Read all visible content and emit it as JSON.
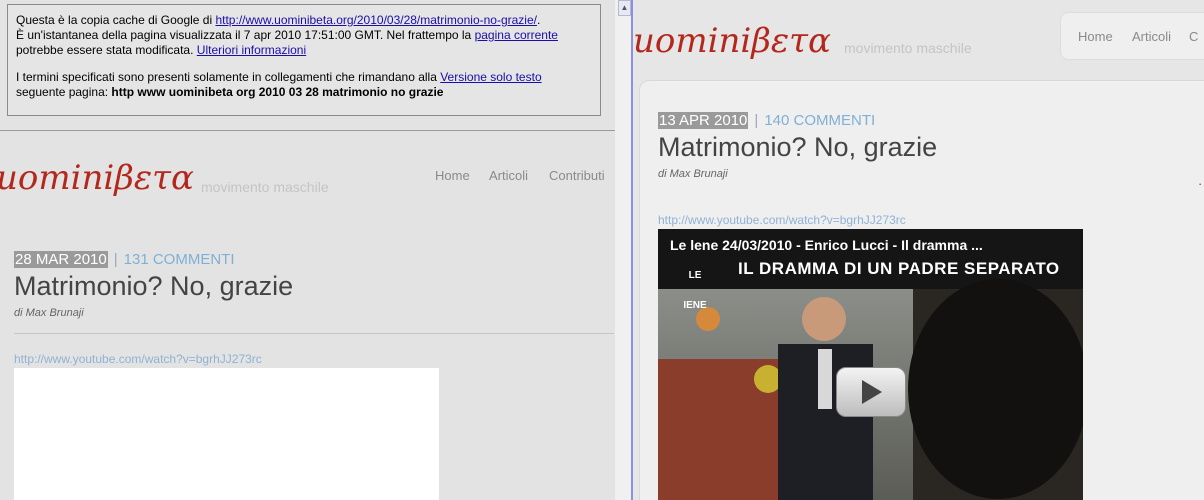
{
  "cache_notice": {
    "line1_prefix": "Questa è la copia cache di Google di ",
    "source_url": "http://www.uominibeta.org/2010/03/28/matrimonio-no-grazie/",
    "line1_suffix": ".",
    "line2_prefix": "È un'istantanea della pagina visualizzata il 7 apr 2010 17:51:00 GMT. Nel frattempo la ",
    "current_page_link": "pagina corrente",
    "line2_middle": " potrebbe essere stata modificata. ",
    "more_info_link": "Ulteriori informazioni",
    "terms_text": "I termini specificati sono presenti solamente in collegamenti che rimandano alla ",
    "text_only_link": "Versione solo testo",
    "following_page": "seguente pagina: ",
    "following_page_terms": "http www uominibeta org 2010 03 28 matrimonio no grazie"
  },
  "site": {
    "logo": "uominiβετα",
    "tagline": "movimento maschile",
    "nav": [
      "Home",
      "Articoli",
      "Contributi"
    ],
    "nav_right": [
      "Home",
      "Articoli",
      "C"
    ]
  },
  "left_post": {
    "date": "28 MAR 2010",
    "separator": "|",
    "comments": "131 COMMENTI",
    "title": "Matrimonio? No, grazie",
    "byline": "di Max Brunaji",
    "video_url": "http://www.youtube.com/watch?v=bgrhJJ273rc"
  },
  "right_post": {
    "date": "13 APR 2010",
    "separator": "|",
    "comments": "140 COMMENTI",
    "title": "Matrimonio? No, grazie",
    "byline": "di Max Brunaji",
    "video_url": "http://www.youtube.com/watch?v=bgrhJJ273rc",
    "video": {
      "title": "Le lene 24/03/2010 - Enrico Lucci -  Il dramma ...",
      "banner": "IL DRAMMA DI UN PADRE SEPARATO",
      "logo": "LE IENE"
    }
  },
  "colors": {
    "logo_red": "#b4271c",
    "link_blue": "#1a0dab",
    "comment_blue": "#7fb0d6",
    "background": "#e3e3e3"
  }
}
